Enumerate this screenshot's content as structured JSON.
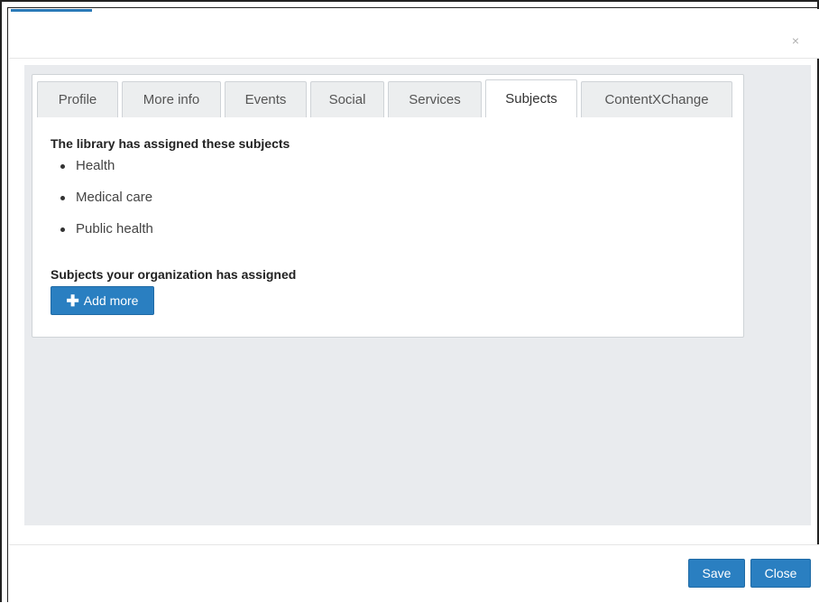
{
  "dialog": {
    "close_symbol": "×"
  },
  "tabs": [
    {
      "label": "Profile"
    },
    {
      "label": "More info"
    },
    {
      "label": "Events"
    },
    {
      "label": "Social"
    },
    {
      "label": "Services"
    },
    {
      "label": "Subjects"
    },
    {
      "label": "ContentXChange"
    }
  ],
  "active_tab": "Subjects",
  "subjects": {
    "library_heading": "The library has assigned these subjects",
    "library_items": [
      "Health",
      "Medical care",
      "Public health"
    ],
    "org_heading": "Subjects your organization has assigned",
    "add_button_icon": "plus-icon",
    "add_button_label": "Add more"
  },
  "footer": {
    "save_label": "Save",
    "close_label": "Close"
  },
  "colors": {
    "primary_button": "#2a7fc1",
    "body_background": "#e9ebee"
  }
}
